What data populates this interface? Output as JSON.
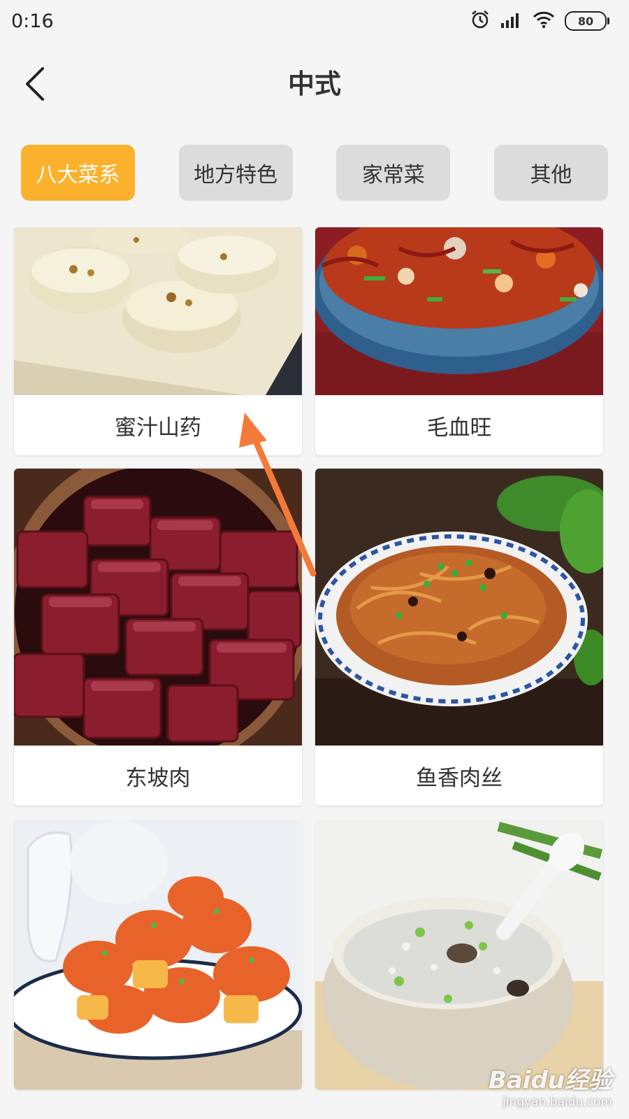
{
  "status": {
    "time": "0:16",
    "battery": "80"
  },
  "header": {
    "title": "中式"
  },
  "tabs": [
    {
      "label": "八大菜系",
      "active": true
    },
    {
      "label": "地方特色",
      "active": false
    },
    {
      "label": "家常菜",
      "active": false
    },
    {
      "label": "其他",
      "active": false
    }
  ],
  "dishes": [
    {
      "name": "蜜汁山药"
    },
    {
      "name": "毛血旺"
    },
    {
      "name": "东坡肉"
    },
    {
      "name": "鱼香肉丝"
    },
    {
      "name": ""
    },
    {
      "name": ""
    }
  ],
  "colors": {
    "accent": "#fbb12b",
    "arrow": "#f47a3a"
  },
  "watermark": {
    "logo": "Baidu经验",
    "url": "jingyan.baidu.com"
  }
}
